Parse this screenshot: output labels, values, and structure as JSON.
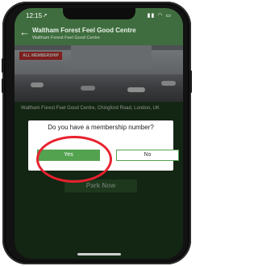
{
  "status": {
    "time": "12:15",
    "location_icon": "location-arrow-icon",
    "signal": "signal-icon",
    "wifi": "wifi-icon",
    "battery": "battery-icon"
  },
  "header": {
    "title": "Waltham Forest Feel Good Centre",
    "subtitle": "Waltham Forest Feel Good Centre",
    "back_icon": "back-arrow-icon"
  },
  "hero": {
    "tag": "ALL MEMBERSHIP"
  },
  "address": "Waltham Forest Feel Good Centre, Chingford Road, London, UK",
  "dialog": {
    "question": "Do you have a membership number?",
    "yes_label": "Yes",
    "no_label": "No"
  },
  "actions": {
    "park_now": "Park Now"
  },
  "colors": {
    "brand_green": "#3f6d3f",
    "button_green": "#53a24f",
    "highlight_red": "#e8212e"
  }
}
